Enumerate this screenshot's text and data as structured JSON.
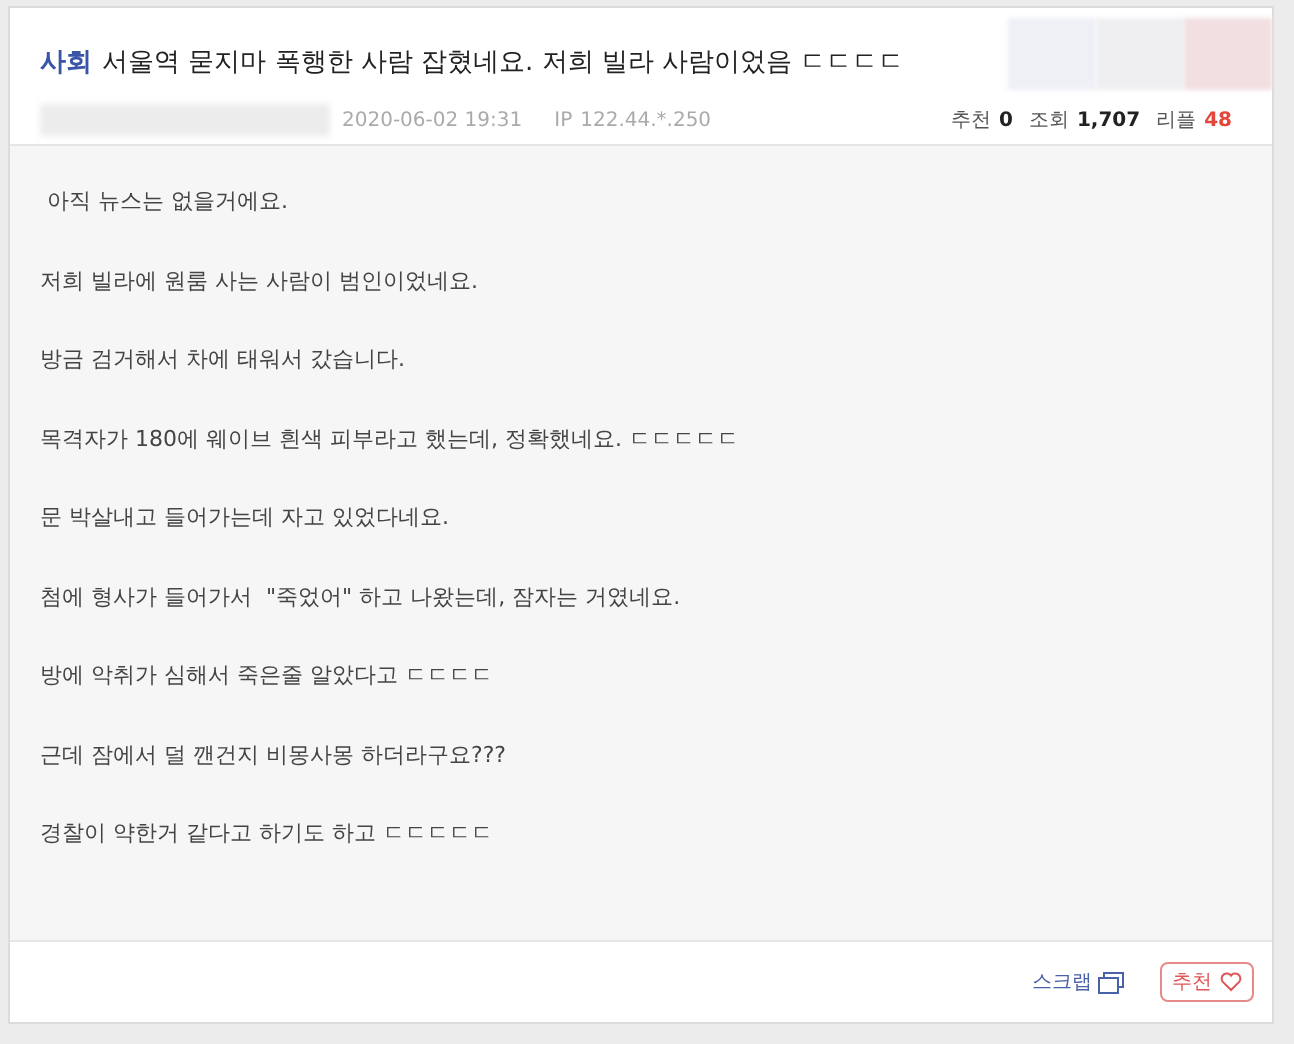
{
  "post": {
    "category": "사회",
    "title": "서울역 묻지마 폭행한 사람 잡혔네요. 저희 빌라 사람이었음 ㄷㄷㄷㄷ",
    "datetime": "2020-06-02 19:31",
    "ip_label": "IP",
    "ip": "122.44.*.250",
    "stats": [
      {
        "label": "추천",
        "value": "0",
        "highlight": false
      },
      {
        "label": "조회",
        "value": "1,707",
        "highlight": false
      },
      {
        "label": "리플",
        "value": "48",
        "highlight": true
      }
    ]
  },
  "body": [
    " 아직 뉴스는 없을거에요.",
    "저희 빌라에 원룸 사는 사람이 범인이었네요.",
    "방금 검거해서 차에 태워서 갔습니다.",
    "목격자가 180에 웨이브 흰색 피부라고 했는데, 정확했네요. ㄷㄷㄷㄷㄷ",
    "문 박살내고 들어가는데 자고 있었다네요.",
    "첨에 형사가 들어가서  \"죽었어\" 하고 나왔는데, 잠자는 거였네요.",
    "방에 악취가 심해서 죽은줄 알았다고 ㄷㄷㄷㄷ",
    "근데 잠에서 덜 깬건지 비몽사몽 하더라구요???",
    "경찰이 약한거 같다고 하기도 하고 ㄷㄷㄷㄷㄷ"
  ],
  "footer": {
    "scrap": "스크랩",
    "recommend": "추천"
  }
}
